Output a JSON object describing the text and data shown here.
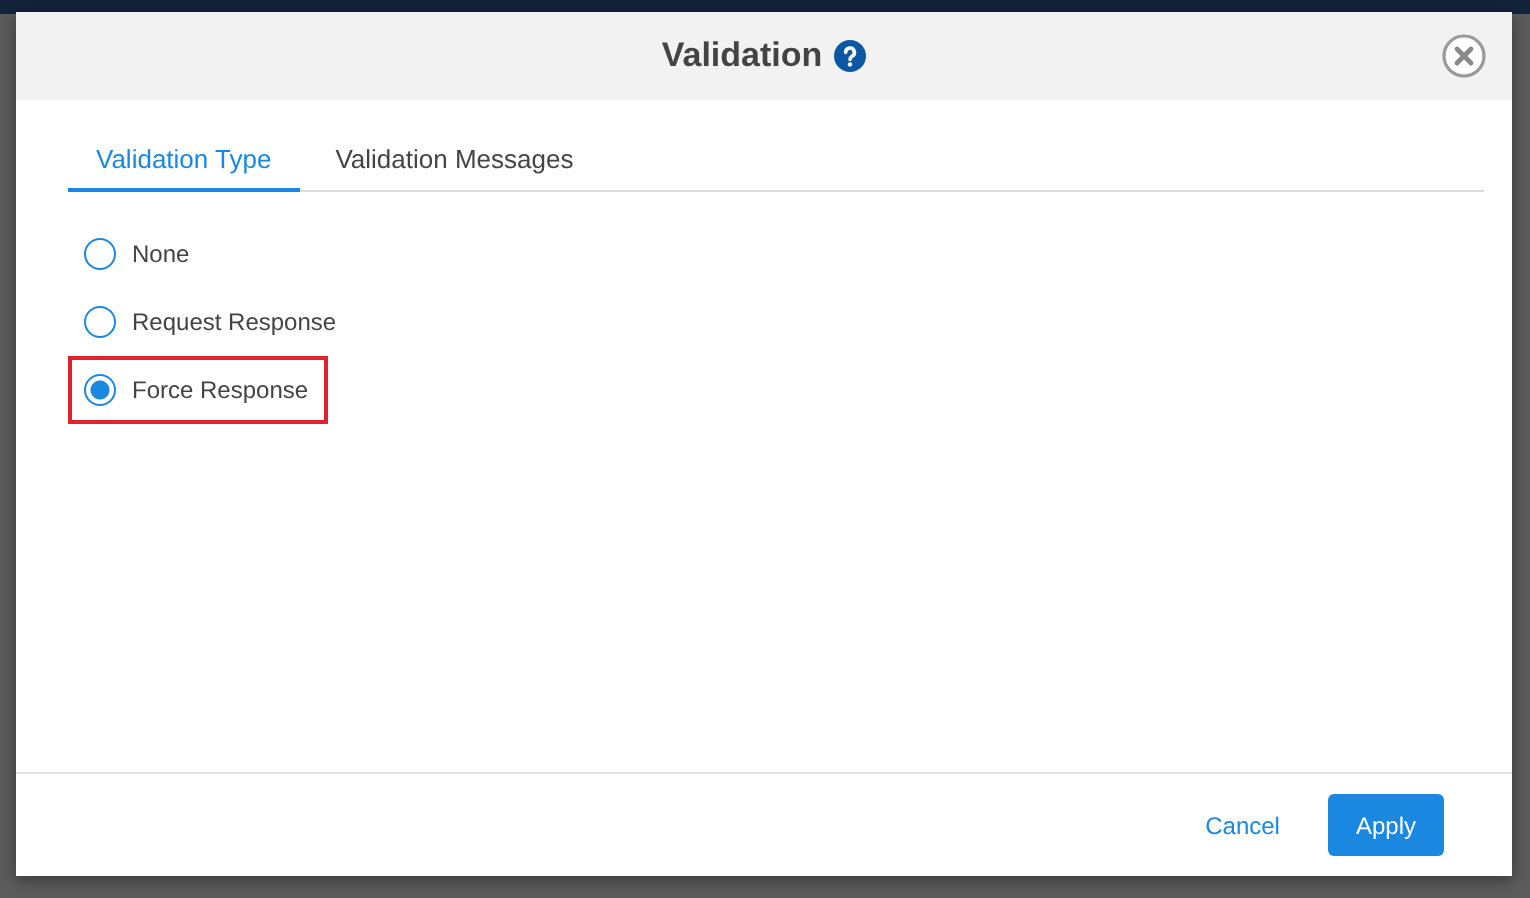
{
  "dialog": {
    "title": "Validation"
  },
  "tabs": [
    {
      "label": "Validation Type",
      "selected": true
    },
    {
      "label": "Validation Messages",
      "selected": false
    }
  ],
  "options": [
    {
      "label": "None",
      "selected": false,
      "highlighted": false
    },
    {
      "label": "Request Response",
      "selected": false,
      "highlighted": false
    },
    {
      "label": "Force Response",
      "selected": true,
      "highlighted": true
    }
  ],
  "buttons": [
    {
      "label": "Cancel",
      "kind": "link"
    },
    {
      "label": "Apply",
      "kind": "primary"
    }
  ]
}
